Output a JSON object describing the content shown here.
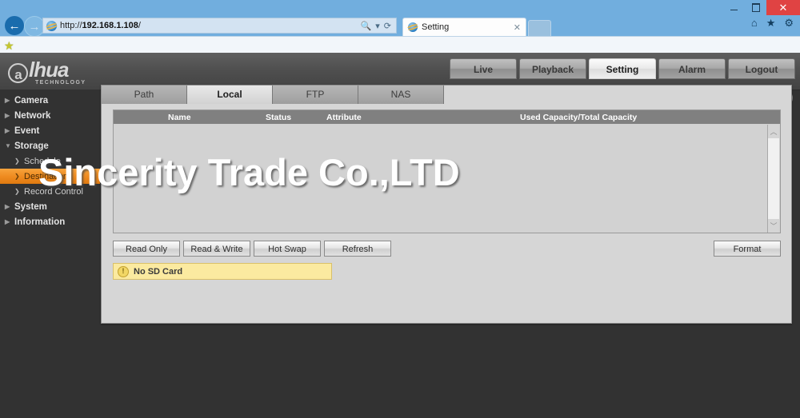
{
  "browser": {
    "url_scheme": "http://",
    "url_host": "192.168.1.108",
    "url_path": "/",
    "search_icon": "search-icon",
    "dropdown_icon": "▾",
    "refresh_icon": "⟳",
    "tab_title": "Setting",
    "tab_close": "✕",
    "minimize": "minimize-icon",
    "maximize": "maximize-icon",
    "close": "✕",
    "command_icons": [
      "home-icon",
      "favorites-star-icon",
      "tools-gear-icon"
    ],
    "command_glyphs": [
      "⌂",
      "★",
      "✿"
    ],
    "favorites_star": "★"
  },
  "device": {
    "logo": {
      "at": "a",
      "text": "lhua",
      "subtitle": "TECHNOLOGY"
    },
    "topnav": [
      {
        "label": "Live",
        "active": false
      },
      {
        "label": "Playback",
        "active": false
      },
      {
        "label": "Setting",
        "active": true
      },
      {
        "label": "Alarm",
        "active": false
      },
      {
        "label": "Logout",
        "active": false
      }
    ],
    "help_label": "?",
    "sidebar": [
      {
        "label": "Camera",
        "level": "top",
        "arrow": "▶",
        "selected": false
      },
      {
        "label": "Network",
        "level": "top",
        "arrow": "▶",
        "selected": false
      },
      {
        "label": "Event",
        "level": "top",
        "arrow": "▶",
        "selected": false
      },
      {
        "label": "Storage",
        "level": "top",
        "arrow": "▼",
        "selected": false
      },
      {
        "label": "Schedule",
        "level": "sub",
        "arrow": "❯",
        "selected": false
      },
      {
        "label": "Destination",
        "level": "sub",
        "arrow": "❯",
        "selected": true
      },
      {
        "label": "Record Control",
        "level": "sub",
        "arrow": "❯",
        "selected": false
      },
      {
        "label": "System",
        "level": "top",
        "arrow": "▶",
        "selected": false
      },
      {
        "label": "Information",
        "level": "top",
        "arrow": "▶",
        "selected": false
      }
    ],
    "tabs": [
      {
        "label": "Path",
        "active": false
      },
      {
        "label": "Local",
        "active": true
      },
      {
        "label": "FTP",
        "active": false
      },
      {
        "label": "NAS",
        "active": false
      }
    ],
    "table": {
      "columns": [
        "Name",
        "Status",
        "Attribute",
        "Used Capacity/Total Capacity"
      ],
      "rows": []
    },
    "scrollbar": {
      "up": "︿",
      "down": "﹀"
    },
    "buttons": [
      {
        "label": "Read Only"
      },
      {
        "label": "Read & Write"
      },
      {
        "label": "Hot Swap"
      },
      {
        "label": "Refresh"
      }
    ],
    "format_button": "Format",
    "warning": {
      "icon": "!",
      "text": "No SD Card"
    }
  },
  "watermark": {
    "text": "Sincerity Trade Co.,LTD"
  },
  "colors": {
    "accent_orange": "#ef8c21",
    "chrome_blue": "#71aede",
    "panel_gray": "#d6d6d6",
    "warn_yellow": "#fbeaa0",
    "close_red": "#e04343"
  }
}
